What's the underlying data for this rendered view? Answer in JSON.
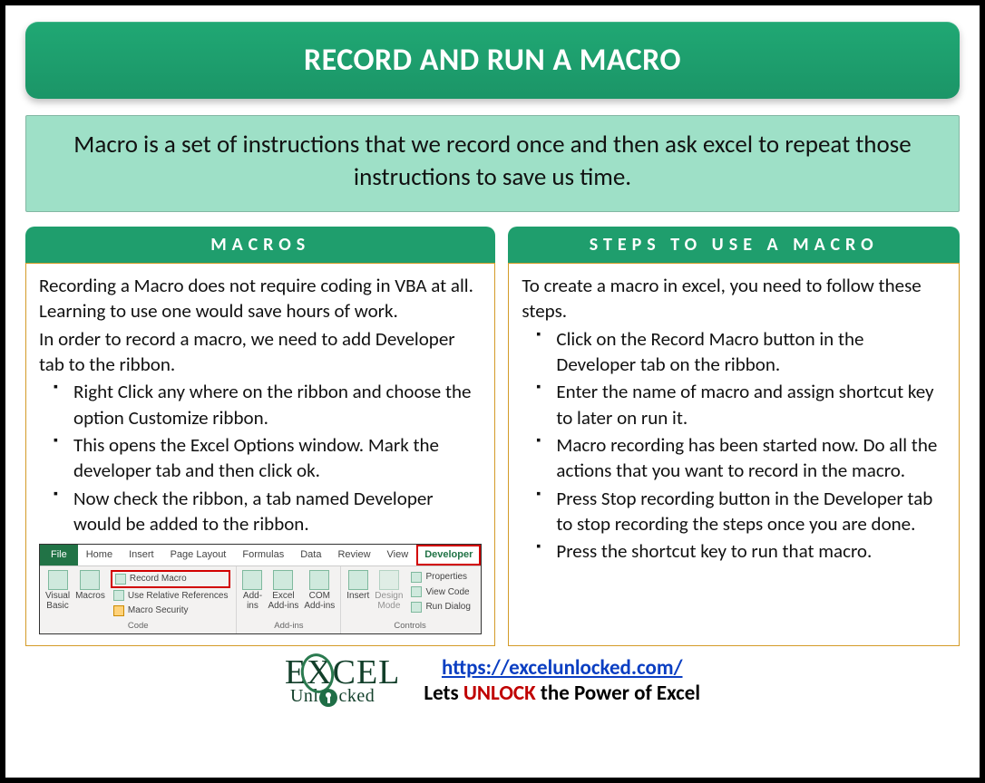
{
  "title": "RECORD AND RUN A MACRO",
  "definition": "Macro is a set of instructions that we record once and then ask excel to repeat those instructions to save us time.",
  "left": {
    "header": "MACROS",
    "intro1": "Recording a Macro does not require coding in VBA at all. Learning to use one would save hours of work.",
    "intro2": "In order to record a macro, we need to add Developer tab to the ribbon.",
    "bullets": [
      "Right Click any where on the ribbon and choose the option Customize ribbon.",
      "This opens the Excel Options window. Mark the developer tab and then click ok.",
      "Now check the ribbon, a tab named Developer would be added to the ribbon."
    ]
  },
  "right": {
    "header": "STEPS TO USE A MACRO",
    "intro": "To create a macro in excel, you need to follow these steps.",
    "bullets": [
      "Click on the Record Macro button in the Developer tab on the ribbon.",
      "Enter the name of macro and assign shortcut key to later on run it.",
      "Macro recording has been started now. Do all the actions that  you want to record in the macro.",
      "Press Stop recording button in the Developer tab to stop recording the steps once you are done.",
      "Press the shortcut key to run that macro."
    ]
  },
  "ribbon": {
    "tabs": [
      "File",
      "Home",
      "Insert",
      "Page Layout",
      "Formulas",
      "Data",
      "Review",
      "View",
      "Developer"
    ],
    "code": {
      "visual_basic": "Visual\nBasic",
      "macros": "Macros",
      "record_macro": "Record Macro",
      "use_relative": "Use Relative References",
      "macro_security": "Macro Security",
      "group": "Code"
    },
    "addins": {
      "addins": "Add-\nins",
      "excel_addins": "Excel\nAdd-ins",
      "com_addins": "COM\nAdd-ins",
      "group": "Add-ins"
    },
    "controls": {
      "insert": "Insert",
      "design_mode": "Design\nMode",
      "properties": "Properties",
      "view_code": "View Code",
      "run_dialog": "Run Dialog",
      "group": "Controls"
    }
  },
  "footer": {
    "brand_top_before_x": "E",
    "brand_top_x": "X",
    "brand_top_after_x": "CEL",
    "brand_bot_left": "Unl",
    "brand_bot_right": "cked",
    "url": "https://excelunlocked.com/",
    "tagline_before": "Lets ",
    "tagline_unlock": "UNLOCK",
    "tagline_after": " the Power of Excel"
  }
}
